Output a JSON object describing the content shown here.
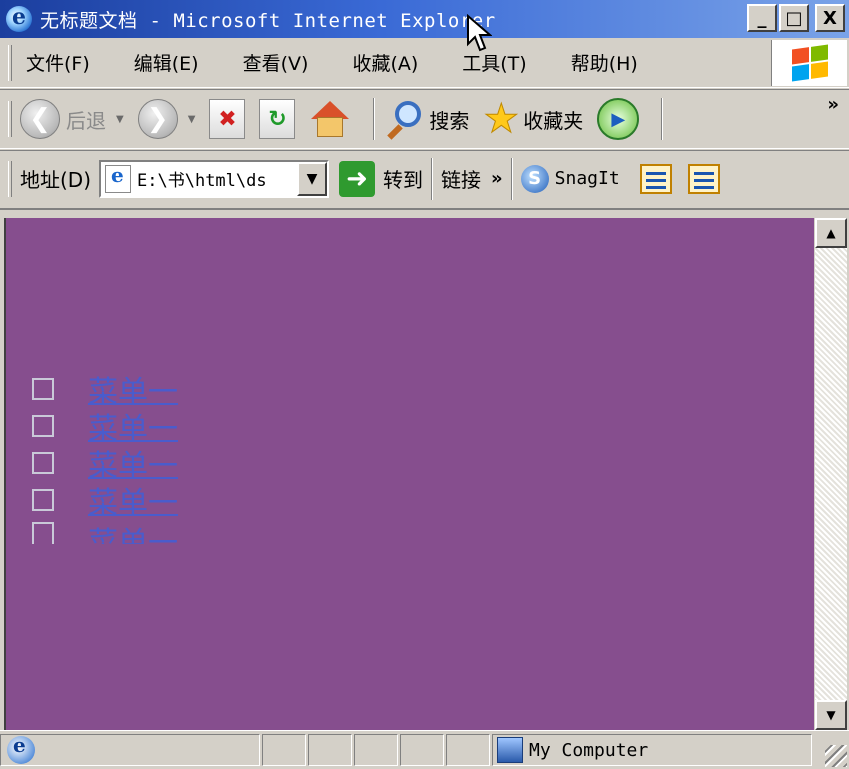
{
  "window": {
    "title": "无标题文档 - Microsoft Internet Explorer",
    "controls": [
      "_",
      "□",
      "X"
    ]
  },
  "menubar": {
    "items": [
      {
        "label": "文件(F)"
      },
      {
        "label": "编辑(E)"
      },
      {
        "label": "查看(V)"
      },
      {
        "label": "收藏(A)"
      },
      {
        "label": "工具(T)"
      },
      {
        "label": "帮助(H)"
      }
    ]
  },
  "toolbar": {
    "back_label": "后退",
    "search_label": "搜索",
    "favorites_label": "收藏夹",
    "overflow": "»"
  },
  "addressbar": {
    "label": "地址(D)",
    "value": "E:\\书\\html\\ds",
    "go_label": "转到",
    "links_label": "链接",
    "links_overflow": "»",
    "snagit_label": "SnagIt"
  },
  "page": {
    "background": "#864e8e",
    "link_color": "#4a5ccc",
    "menu_items": [
      {
        "label": "菜单一"
      },
      {
        "label": "菜单一"
      },
      {
        "label": "菜单一"
      },
      {
        "label": "菜单一"
      },
      {
        "label": "菜单一"
      }
    ]
  },
  "statusbar": {
    "zone_label": "My Computer"
  }
}
